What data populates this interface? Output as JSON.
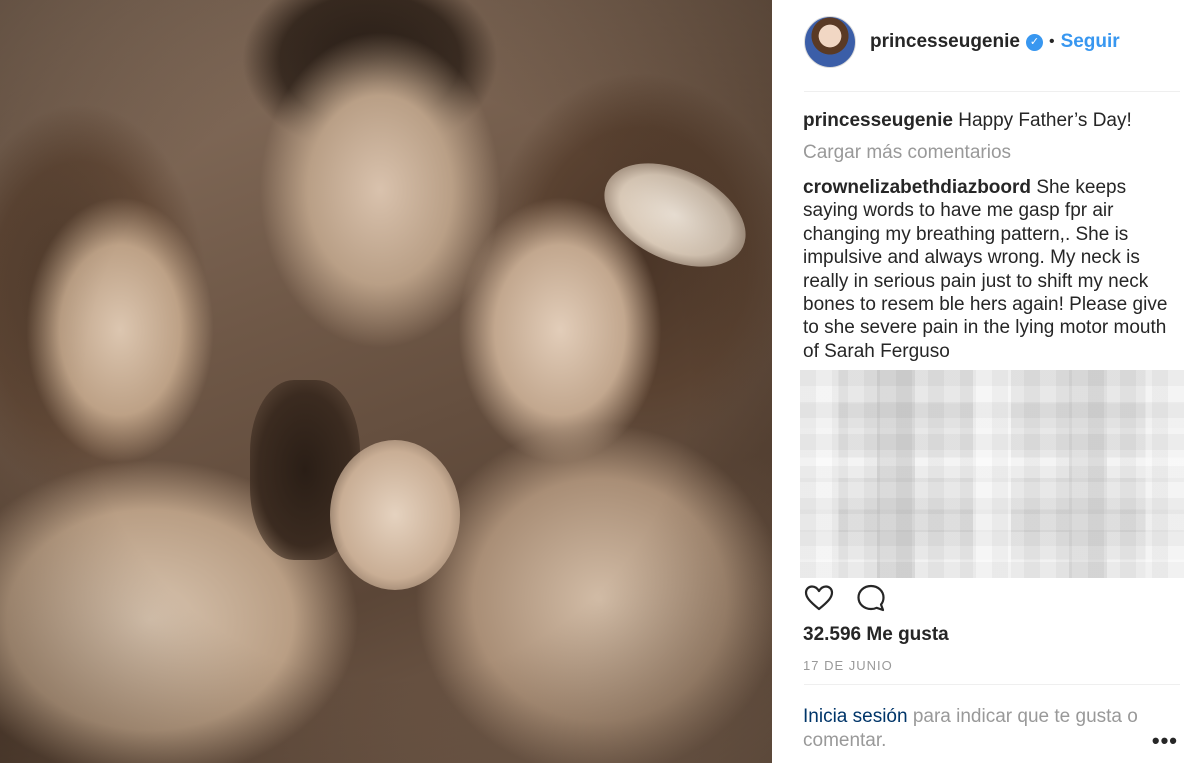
{
  "post": {
    "username": "princesseugenie",
    "verified_icon": "verified-badge-icon",
    "separator": "•",
    "follow_label": "Seguir",
    "caption_text": "Happy Father’s Day!",
    "load_more": "Cargar más comentarios",
    "comment": {
      "username": "crownelizabethdiazboord",
      "text": "She keeps saying words to have me gasp fpr air changing my breathing pattern,. She is impulsive and always wrong. My neck is really in serious pain just to shift my neck bones to resem ble hers again! Please give to she severe pain in the lying motor mouth of Sarah Ferguso"
    },
    "likes": "32.596 Me gusta",
    "date": "17 DE JUNIO",
    "login_link": "Inicia sesión",
    "login_rest": " para indicar que te gusta o comentar.",
    "more_label": "•••"
  },
  "colors": {
    "accent": "#3897f0",
    "link_dark": "#003569",
    "muted": "#999999",
    "text": "#262626"
  },
  "icons": [
    "heart-icon",
    "comment-icon",
    "verified-badge-icon",
    "more-options-icon"
  ]
}
